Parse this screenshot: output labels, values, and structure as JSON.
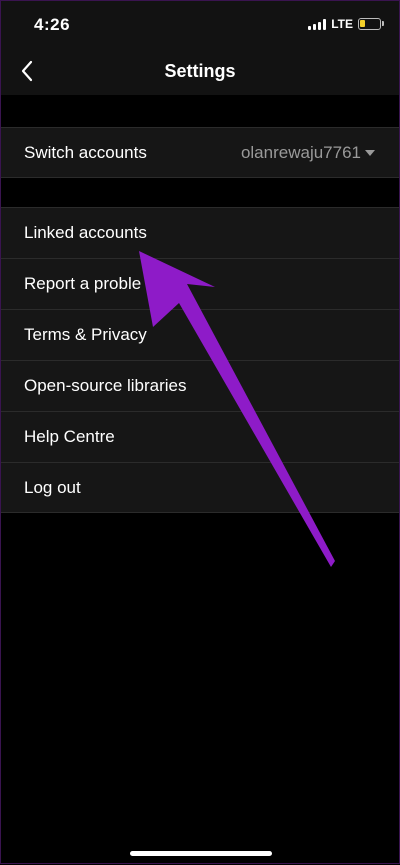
{
  "status_bar": {
    "time": "4:26",
    "network": "LTE",
    "battery_level": 0.25,
    "battery_color": "#f3cf2a"
  },
  "nav": {
    "title": "Settings",
    "back_icon": "chevron-left-icon"
  },
  "account": {
    "label": "Switch accounts",
    "value": "olanrewaju7761",
    "dropdown_icon": "caret-down-icon"
  },
  "menu": [
    {
      "label": "Linked accounts"
    },
    {
      "label": "Report a proble"
    },
    {
      "label": "Terms & Privacy"
    },
    {
      "label": "Open-source libraries"
    },
    {
      "label": "Help Centre"
    },
    {
      "label": "Log out"
    }
  ],
  "annotation": {
    "arrow_color": "#8e1bc8",
    "points_to": "Linked accounts"
  }
}
